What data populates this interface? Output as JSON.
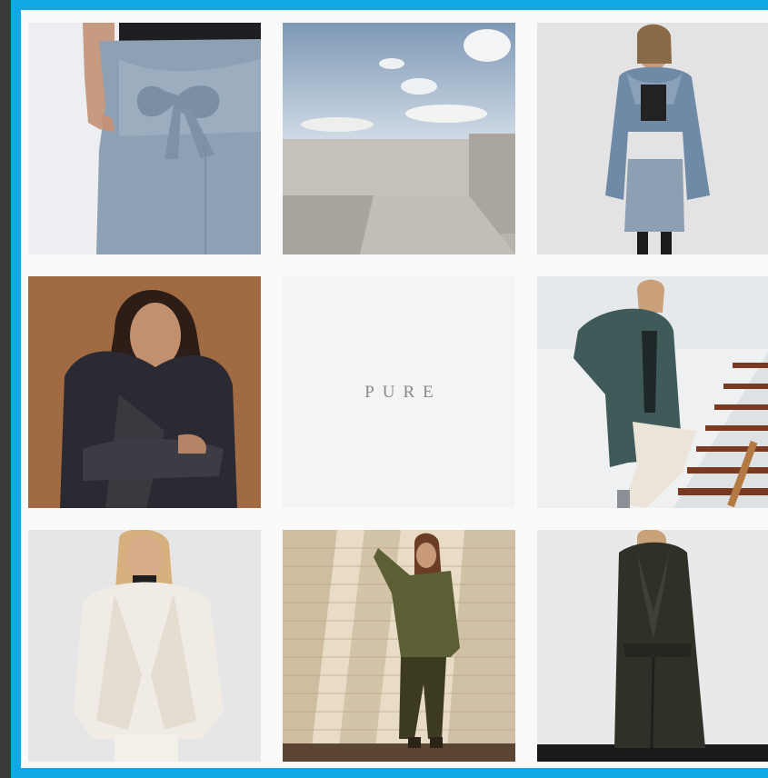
{
  "grid": {
    "tiles": [
      {
        "name": "photo-suede-skirt",
        "kind": "photo"
      },
      {
        "name": "photo-concrete-sky",
        "kind": "photo"
      },
      {
        "name": "photo-blue-fur-jacket",
        "kind": "photo"
      },
      {
        "name": "photo-dark-fur-coat",
        "kind": "photo"
      },
      {
        "name": "brand-tile",
        "kind": "text",
        "text": "PURE"
      },
      {
        "name": "photo-green-leather-coat",
        "kind": "photo"
      },
      {
        "name": "photo-white-fur-jacket",
        "kind": "photo"
      },
      {
        "name": "photo-olive-knit-brick-wall",
        "kind": "photo"
      },
      {
        "name": "photo-black-shearling-coat",
        "kind": "photo"
      }
    ]
  },
  "colors": {
    "frame_border": "#12a8e6",
    "background": "#fafafa",
    "outer": "#3a3a3a"
  }
}
